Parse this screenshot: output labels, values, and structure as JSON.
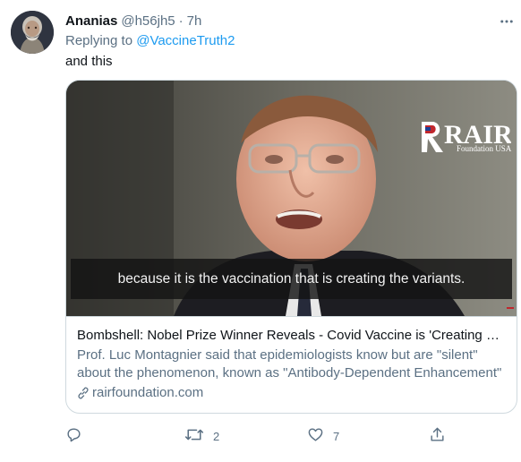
{
  "tweet": {
    "author_name": "Ananias",
    "author_handle": "@h56jh5",
    "separator": "·",
    "time": "7h",
    "replying_prefix": "Replying to ",
    "replying_to": "@VaccineTruth2",
    "text": "and this"
  },
  "card": {
    "caption": "because it is the vaccination that is creating the variants.",
    "logo_text": "RAIR",
    "logo_subtext": "Foundation USA",
    "title": "Bombshell: Nobel Prize Winner Reveals - Covid Vaccine is 'Creating Variants'",
    "description_line1": "Prof. Luc Montagnier said that epidemiologists know but are \"silent\"",
    "description_line2": "about the phenomenon, known as \"Antibody-Dependent Enhancement\"",
    "domain": "rairfoundation.com"
  },
  "actions": {
    "reply_count": "",
    "retweet_count": "2",
    "like_count": "7",
    "share_count": ""
  },
  "colors": {
    "accent": "#1d9bf0",
    "secondary_text": "#5b7083",
    "border": "#cfd9de",
    "logo_red": "#c0272d"
  },
  "icons": [
    "more-icon",
    "reply-icon",
    "retweet-icon",
    "like-icon",
    "share-icon",
    "link-icon"
  ]
}
